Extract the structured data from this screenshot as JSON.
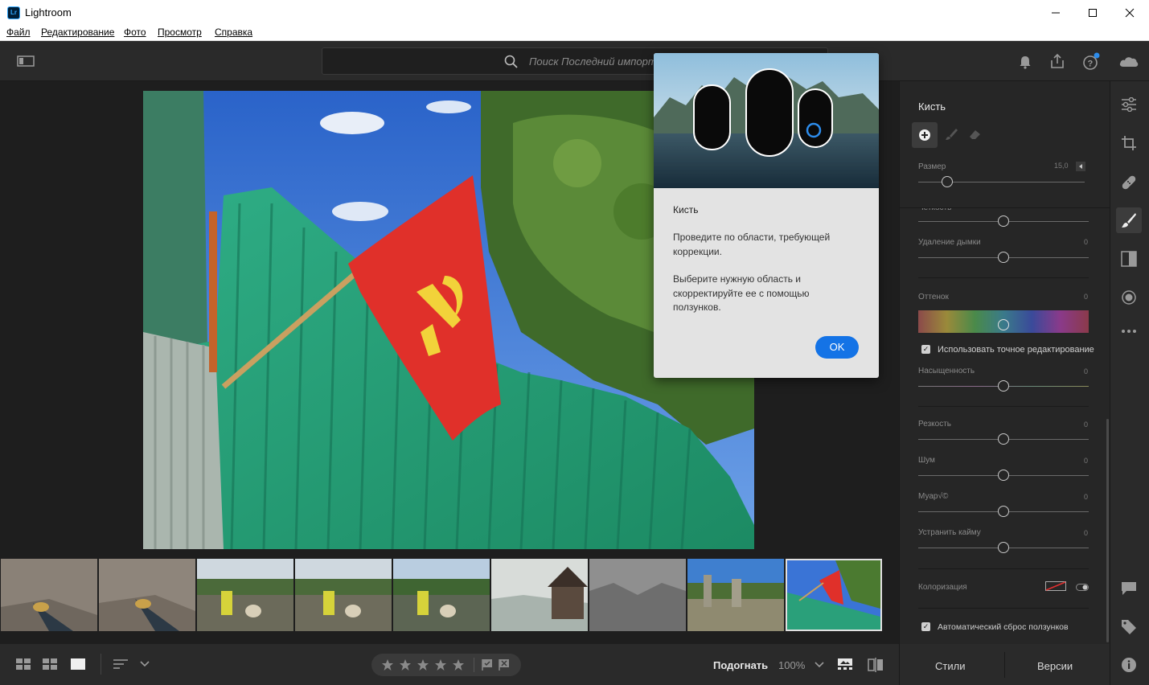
{
  "window": {
    "title": "Lightroom",
    "icon_text": "Lr",
    "controls": [
      "minimize-icon",
      "maximize-icon",
      "close-icon"
    ]
  },
  "menu": {
    "items": [
      "Файл",
      "Редактирование",
      "Фото",
      "Просмотр",
      "Справка"
    ]
  },
  "toolbar": {
    "search_placeholder": "Поиск Последний импорт",
    "icons": [
      "panel-toggle-icon",
      "search-icon",
      "bell-icon",
      "share-icon",
      "help-icon",
      "cloud-icon"
    ]
  },
  "popover": {
    "title": "Кисть",
    "text1": "Проведите по области, требующей коррекции.",
    "text2": "Выберите нужную область и скорректируйте ее с помощью ползунков.",
    "ok": "OK"
  },
  "panel": {
    "title": "Кисть",
    "size_label": "Размер",
    "size_value": "15,0",
    "size_level": 0.17,
    "partial_label": "Четкость",
    "sliders": [
      {
        "label": "Удаление дымки",
        "value": "0"
      },
      {
        "label": "Оттенок",
        "value": "0"
      },
      {
        "label": "Насыщенность",
        "value": "0"
      },
      {
        "label": "Резкость",
        "value": "0"
      },
      {
        "label": "Шум",
        "value": "0"
      },
      {
        "label": "Муар√©",
        "value": "0"
      },
      {
        "label": "Устранить кайму",
        "value": "0"
      }
    ],
    "precise_edit": "Использовать точное редактирование",
    "colorize": "Колоризация",
    "auto_reset": "Автоматический сброс ползунков",
    "styles_btn": "Стили",
    "versions_btn": "Версии"
  },
  "bottombar": {
    "fit": "Подогнать",
    "zoom": "100%"
  },
  "iconstrip": [
    "edit-sliders-icon",
    "crop-icon",
    "healing-icon",
    "brush-icon",
    "linear-gradient-icon",
    "radial-gradient-icon",
    "more-icon",
    "comment-icon",
    "tag-icon",
    "info-icon"
  ],
  "colors": {
    "accent": "#1473e6",
    "bg": "#1e1e1e",
    "panel": "#262626"
  }
}
